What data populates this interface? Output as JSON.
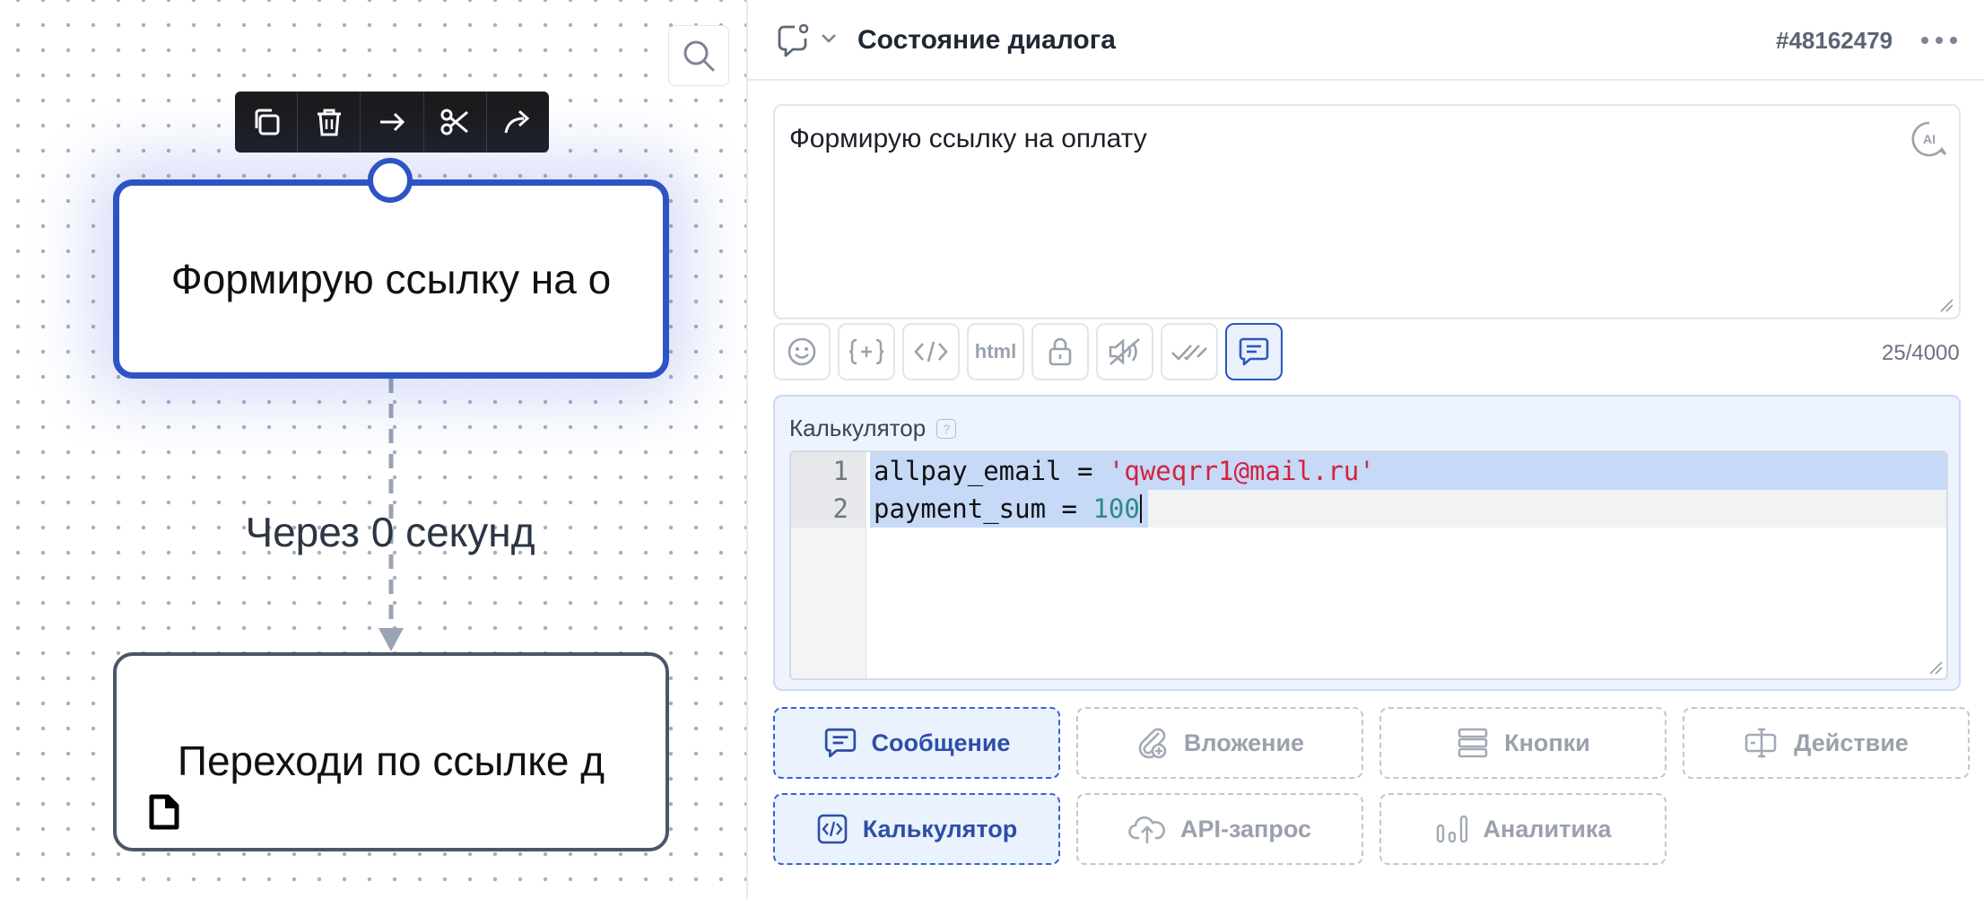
{
  "canvas": {
    "selected_node": {
      "text": "Формирую ссылку на о"
    },
    "edge_label": "Через 0 секунд",
    "second_node": {
      "text": "Переходи по ссылке д"
    },
    "toolbar_icons": [
      "copy-icon",
      "trash-icon",
      "arrow-right-icon",
      "scissors-icon",
      "share-icon"
    ]
  },
  "panel": {
    "header": {
      "title": "Состояние диалога",
      "id": "#48162479"
    },
    "message": {
      "text": "Формирую ссылку на оплату",
      "char_count": "25/4000"
    },
    "format_toolbar": {
      "html_label": "html"
    },
    "calculator": {
      "label": "Калькулятор",
      "help": "?",
      "lines": [
        {
          "num": "1",
          "var": "allpay_email",
          "op": " = ",
          "value": "'qweqrr1@mail.ru'"
        },
        {
          "num": "2",
          "var": "payment_sum",
          "op": " = ",
          "value": "100"
        }
      ]
    },
    "blocks": [
      {
        "label": "Сообщение",
        "icon": "message-icon",
        "active": true
      },
      {
        "label": "Вложение",
        "icon": "attachment-icon",
        "active": false
      },
      {
        "label": "Кнопки",
        "icon": "buttons-icon",
        "active": false
      },
      {
        "label": "Действие",
        "icon": "action-icon",
        "active": false
      },
      {
        "label": "Калькулятор",
        "icon": "code-icon",
        "active": true
      },
      {
        "label": "API-запрос",
        "icon": "cloud-upload-icon",
        "active": false
      },
      {
        "label": "Аналитика",
        "icon": "analytics-icon",
        "active": false
      }
    ]
  },
  "colors": {
    "accent": "#2d54c4",
    "node_border": "#4b5669",
    "string": "#d1243f",
    "number": "#2c8a8a",
    "selection": "#c6d9f7"
  }
}
